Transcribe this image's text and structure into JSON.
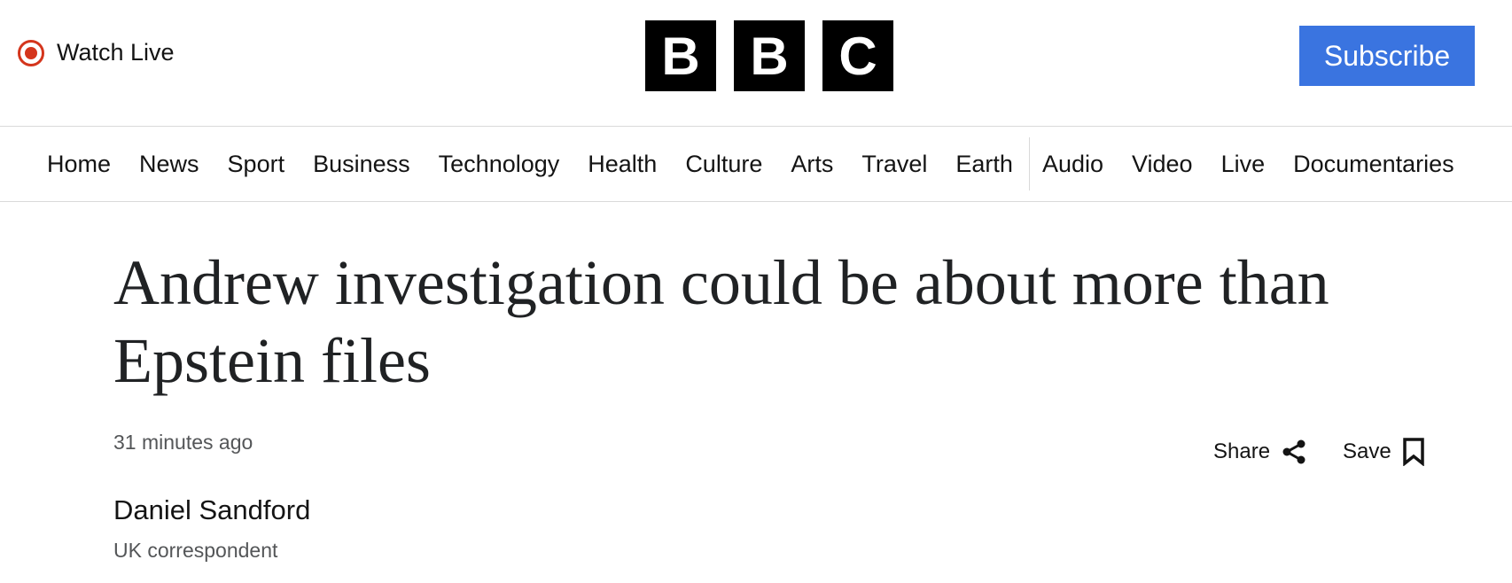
{
  "header": {
    "watch_live": "Watch Live",
    "logo_letters": [
      "B",
      "B",
      "C"
    ],
    "subscribe": "Subscribe",
    "accent_color": "#3a74e0",
    "live_color": "#d4351c"
  },
  "nav": {
    "items": [
      "Home",
      "News",
      "Sport",
      "Business",
      "Technology",
      "Health",
      "Culture",
      "Arts",
      "Travel",
      "Earth",
      "Audio",
      "Video",
      "Live",
      "Documentaries"
    ]
  },
  "article": {
    "headline": "Andrew investigation could be about more than Epstein files",
    "timestamp": "31 minutes ago",
    "share_label": "Share",
    "save_label": "Save",
    "author_name": "Daniel Sandford",
    "author_role": "UK correspondent"
  },
  "icons": {
    "live": "live-indicator-icon",
    "share": "share-icon",
    "save": "bookmark-icon"
  }
}
